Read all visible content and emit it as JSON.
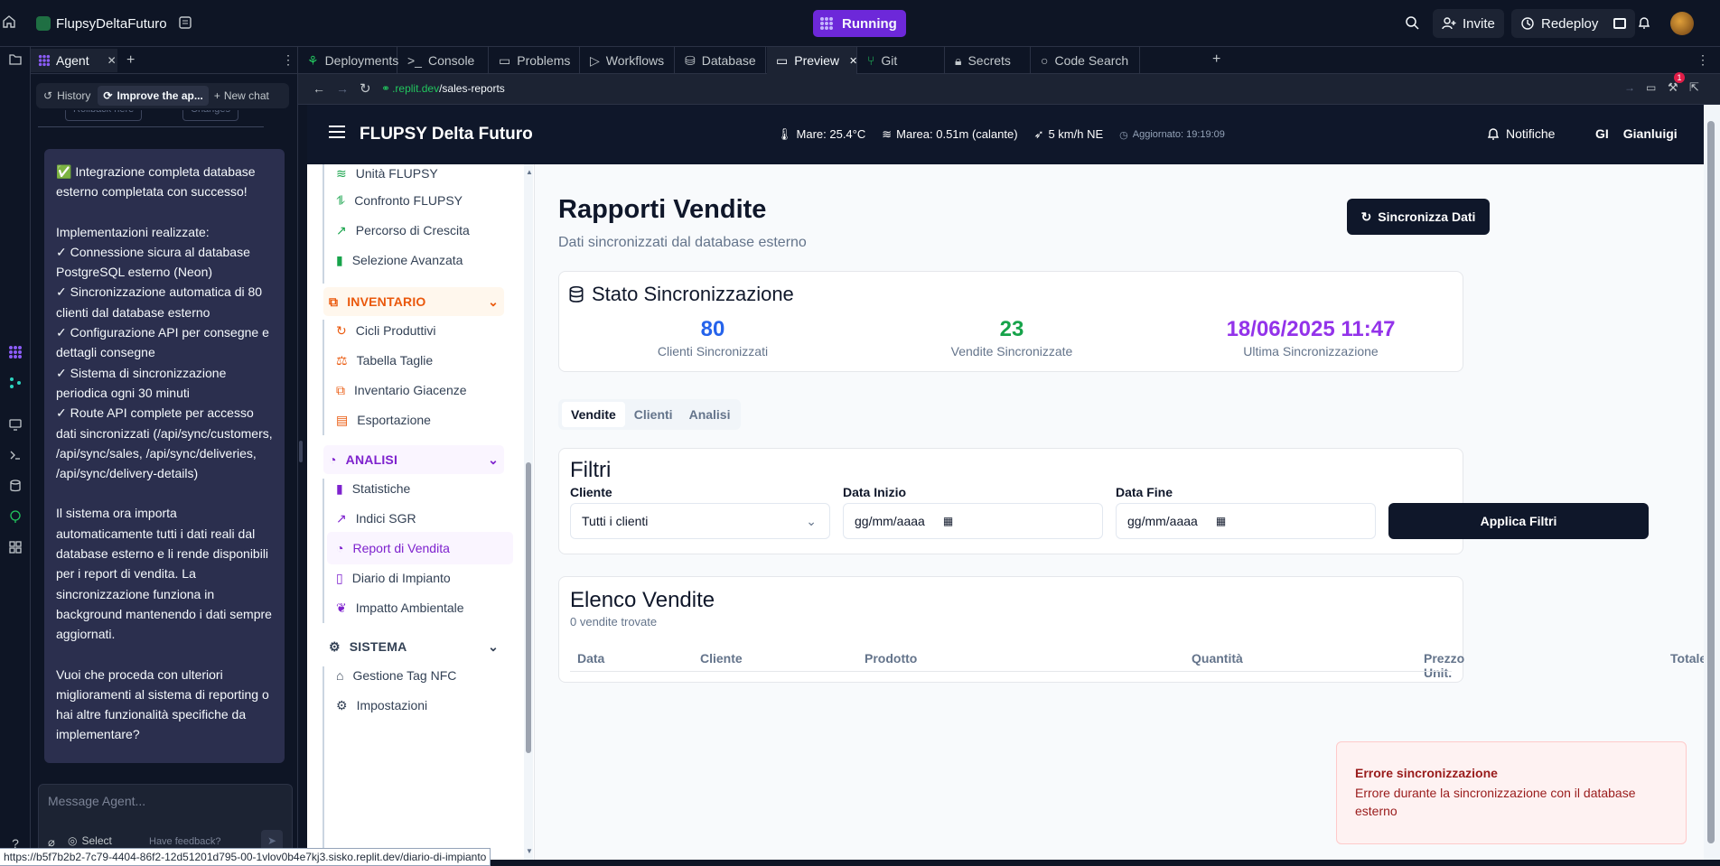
{
  "topbar": {
    "project_name": "FlupsyDeltaFuturo",
    "run_status": "Running",
    "invite_label": "Invite",
    "redeploy_label": "Redeploy",
    "notification_badge": "1"
  },
  "agent_panel": {
    "tab_label": "Agent",
    "history_label": "History",
    "current_chat_label": "Improve the ap...",
    "new_chat_label": "New chat",
    "rollback_label": "Rollback here",
    "changes_label": "Changes",
    "message": {
      "p1": "✅ Integrazione completa database esterno completata con successo!",
      "p2_title": "Implementazioni realizzate:",
      "p2_items": [
        "✓ Connessione sicura al database PostgreSQL esterno (Neon)",
        "✓ Sincronizzazione automatica di 80 clienti dal database esterno",
        "✓ Configurazione API per consegne e dettagli consegne",
        "✓ Sistema di sincronizzazione periodica ogni 30 minuti",
        "✓ Route API complete per accesso dati sincronizzati (/api/sync/customers, /api/sync/sales, /api/sync/deliveries, /api/sync/delivery-details)"
      ],
      "p3": "Il sistema ora importa automaticamente tutti i dati reali dal database esterno e li rende disponibili per i report di vendita. La sincronizzazione funziona in background mantenendo i dati sempre aggiornati.",
      "p4": "Vuoi che proceda con ulteriori miglioramenti al sistema di reporting o hai altre funzionalità specifiche da implementare?"
    },
    "input_placeholder": "Message Agent...",
    "select_label": "Select",
    "feedback_label": "Have feedback?"
  },
  "workspace_tabs": [
    {
      "label": "Deployments"
    },
    {
      "label": "Console"
    },
    {
      "label": "Problems"
    },
    {
      "label": "Workflows"
    },
    {
      "label": "Database"
    },
    {
      "label": "Preview"
    },
    {
      "label": "Git"
    },
    {
      "label": "Secrets"
    },
    {
      "label": "Code Search"
    }
  ],
  "urlbar": {
    "domain": ".replit.dev",
    "path": "/sales-reports"
  },
  "app": {
    "title": "FLUPSY Delta Futuro",
    "weather": {
      "sea_temp": "Mare: 25.4°C",
      "tide": "Marea: 0.51m (calante)",
      "wind": "5 km/h NE",
      "updated": "Aggiornato: 19:19:09"
    },
    "notifications_label": "Notifiche",
    "user_initials": "GI",
    "user_name": "Gianluigi",
    "sidebar": {
      "items_top": [
        "Unità FLUPSY",
        "Confronto FLUPSY",
        "Percorso di Crescita",
        "Selezione Avanzata"
      ],
      "group_inventario": "INVENTARIO",
      "items_inventario": [
        "Cicli Produttivi",
        "Tabella Taglie",
        "Inventario Giacenze",
        "Esportazione"
      ],
      "group_analisi": "ANALISI",
      "items_analisi": [
        "Statistiche",
        "Indici SGR",
        "Report di Vendita",
        "Diario di Impianto",
        "Impatto Ambientale"
      ],
      "group_sistema": "SISTEMA",
      "items_sistema": [
        "Gestione Tag NFC",
        "Impostazioni"
      ]
    },
    "page": {
      "title": "Rapporti Vendite",
      "subtitle": "Dati sincronizzati dal database esterno",
      "sync_button": "Sincronizza Dati",
      "sync_card": {
        "title": "Stato Sincronizzazione",
        "clients_value": "80",
        "clients_label": "Clienti Sincronizzati",
        "sales_value": "23",
        "sales_label": "Vendite Sincronizzate",
        "last_value": "18/06/2025 11:47",
        "last_label": "Ultima Sincronizzazione"
      },
      "tabs": [
        "Vendite",
        "Clienti",
        "Analisi"
      ],
      "filters": {
        "title": "Filtri",
        "client_label": "Cliente",
        "client_value": "Tutti i clienti",
        "start_label": "Data Inizio",
        "start_placeholder": "gg/mm/aaaa",
        "end_label": "Data Fine",
        "end_placeholder": "gg/mm/aaaa",
        "apply_button": "Applica Filtri"
      },
      "sales_list": {
        "title": "Elenco Vendite",
        "count": "0 vendite trovate",
        "columns": [
          "Data",
          "Cliente",
          "Prodotto",
          "Quantità",
          "Prezzo Unit.",
          "Totale"
        ]
      }
    },
    "toast": {
      "title": "Errore sincronizzazione",
      "message": "Errore durante la sincronizzazione con il database esterno"
    }
  },
  "status_url": "https://b5f7b2b2-7c79-4404-86f2-12d51201d795-00-1vlov0b4e7kj3.sisko.replit.dev/diario-di-impianto",
  "colors": {
    "accent_purple": "#7e22ce",
    "stat_blue": "#2563eb",
    "stat_green": "#16a34a",
    "stat_purple": "#9333ea",
    "inventario_orange": "#ea580c",
    "running_purple": "#6d28d9"
  }
}
